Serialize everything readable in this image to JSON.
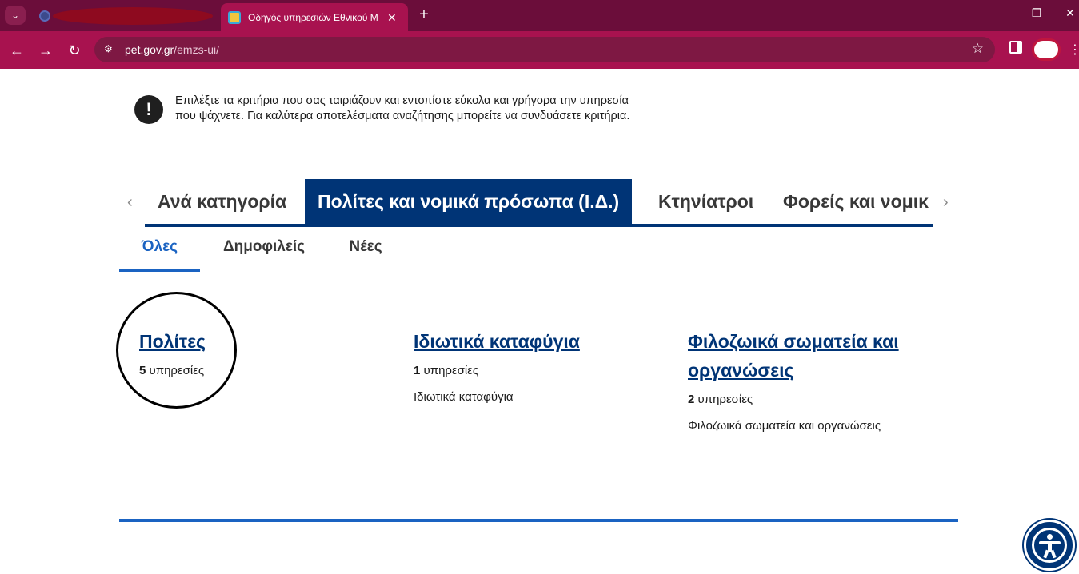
{
  "browser": {
    "active_tab_title": "Οδηγός υπηρεσιών Εθνικού Μ",
    "url_host": "pet.gov.gr",
    "url_path": "/emzs-ui/",
    "new_tab_glyph": "+",
    "close_glyph": "✕"
  },
  "info": {
    "text": "Επιλέξτε τα κριτήρια που σας ταιριάζουν και εντοπίστε εύκολα και γρήγορα την υπηρεσία που ψάχνετε. Για καλύτερα αποτελέσματα αναζήτησης μπορείτε να συνδυάσετε κριτήρια."
  },
  "category_tabs": [
    {
      "label": "Ανά κατηγορία",
      "active": false
    },
    {
      "label": "Πολίτες και νομικά πρόσωπα (Ι.Δ.)",
      "active": true
    },
    {
      "label": "Κτηνίατροι",
      "active": false
    },
    {
      "label": "Φορείς και νομικ",
      "active": false
    }
  ],
  "sub_tabs": [
    {
      "label": "Όλες",
      "active": true
    },
    {
      "label": "Δημοφιλείς",
      "active": false
    },
    {
      "label": "Νέες",
      "active": false
    }
  ],
  "cards": [
    {
      "title": "Πολίτες",
      "count": "5",
      "count_label": "υπηρεσίες",
      "description": ""
    },
    {
      "title": "Ιδιωτικά καταφύγια",
      "count": "1",
      "count_label": "υπηρεσίες",
      "description": "Ιδιωτικά καταφύγια"
    },
    {
      "title": "Φιλοζωικά σωματεία και οργανώσεις",
      "count": "2",
      "count_label": "υπηρεσίες",
      "description": "Φιλοζωικά σωματεία και οργανώσεις"
    }
  ],
  "colors": {
    "brand_navy": "#003476",
    "accent_blue": "#1a63c2",
    "browser_chrome": "#a8124f"
  }
}
